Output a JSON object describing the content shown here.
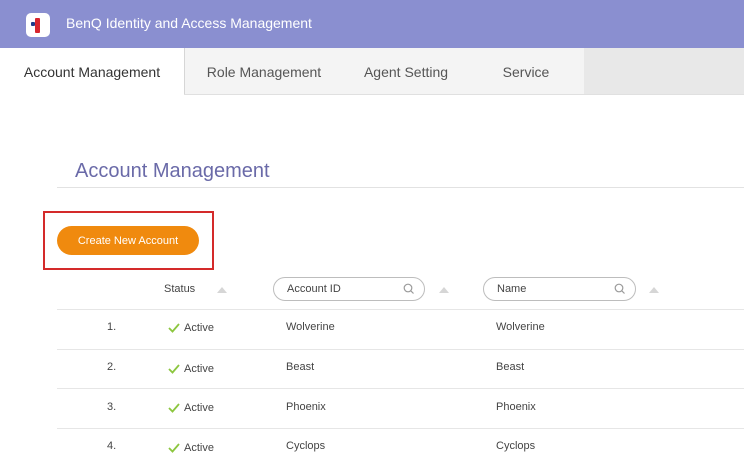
{
  "app": {
    "title": "BenQ Identity and Access Management"
  },
  "tabs": [
    {
      "label": "Account Management"
    },
    {
      "label": "Role Management"
    },
    {
      "label": "Agent Setting"
    },
    {
      "label": "Service"
    }
  ],
  "page": {
    "title": "Account Management"
  },
  "actions": {
    "create_label": "Create New Account"
  },
  "table": {
    "headers": {
      "status": "Status",
      "account_id": "Account ID",
      "name": "Name"
    },
    "rows": [
      {
        "index": "1.",
        "status": "Active",
        "account_id": "Wolverine",
        "name": "Wolverine"
      },
      {
        "index": "2.",
        "status": "Active",
        "account_id": "Beast",
        "name": "Beast"
      },
      {
        "index": "3.",
        "status": "Active",
        "account_id": "Phoenix",
        "name": "Phoenix"
      },
      {
        "index": "4.",
        "status": "Active",
        "account_id": "Cyclops",
        "name": "Cyclops"
      }
    ]
  },
  "colors": {
    "header": "#8a8fd0",
    "accent": "#f08a0e",
    "highlight": "#d42a2a",
    "active": "#8cc63f",
    "title": "#6a6aa8"
  },
  "icons": {
    "logo": "benq-logo",
    "search": "search-icon",
    "sort": "sort-up-icon",
    "status": "check-icon"
  }
}
